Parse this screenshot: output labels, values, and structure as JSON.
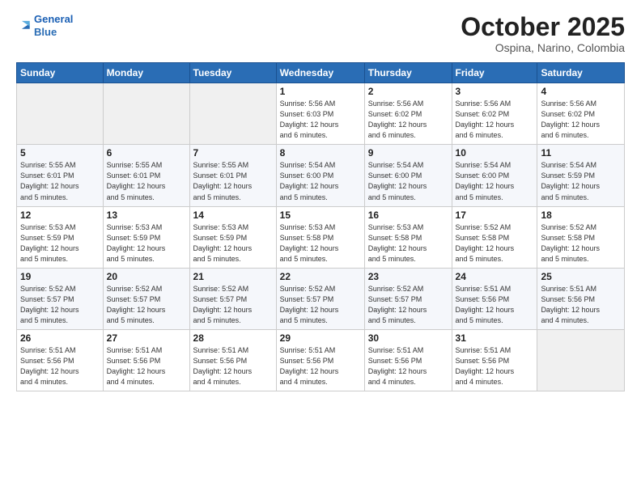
{
  "logo": {
    "line1": "General",
    "line2": "Blue"
  },
  "title": "October 2025",
  "subtitle": "Ospina, Narino, Colombia",
  "weekdays": [
    "Sunday",
    "Monday",
    "Tuesday",
    "Wednesday",
    "Thursday",
    "Friday",
    "Saturday"
  ],
  "weeks": [
    [
      {
        "day": "",
        "info": ""
      },
      {
        "day": "",
        "info": ""
      },
      {
        "day": "",
        "info": ""
      },
      {
        "day": "1",
        "info": "Sunrise: 5:56 AM\nSunset: 6:03 PM\nDaylight: 12 hours\nand 6 minutes."
      },
      {
        "day": "2",
        "info": "Sunrise: 5:56 AM\nSunset: 6:02 PM\nDaylight: 12 hours\nand 6 minutes."
      },
      {
        "day": "3",
        "info": "Sunrise: 5:56 AM\nSunset: 6:02 PM\nDaylight: 12 hours\nand 6 minutes."
      },
      {
        "day": "4",
        "info": "Sunrise: 5:56 AM\nSunset: 6:02 PM\nDaylight: 12 hours\nand 6 minutes."
      }
    ],
    [
      {
        "day": "5",
        "info": "Sunrise: 5:55 AM\nSunset: 6:01 PM\nDaylight: 12 hours\nand 5 minutes."
      },
      {
        "day": "6",
        "info": "Sunrise: 5:55 AM\nSunset: 6:01 PM\nDaylight: 12 hours\nand 5 minutes."
      },
      {
        "day": "7",
        "info": "Sunrise: 5:55 AM\nSunset: 6:01 PM\nDaylight: 12 hours\nand 5 minutes."
      },
      {
        "day": "8",
        "info": "Sunrise: 5:54 AM\nSunset: 6:00 PM\nDaylight: 12 hours\nand 5 minutes."
      },
      {
        "day": "9",
        "info": "Sunrise: 5:54 AM\nSunset: 6:00 PM\nDaylight: 12 hours\nand 5 minutes."
      },
      {
        "day": "10",
        "info": "Sunrise: 5:54 AM\nSunset: 6:00 PM\nDaylight: 12 hours\nand 5 minutes."
      },
      {
        "day": "11",
        "info": "Sunrise: 5:54 AM\nSunset: 5:59 PM\nDaylight: 12 hours\nand 5 minutes."
      }
    ],
    [
      {
        "day": "12",
        "info": "Sunrise: 5:53 AM\nSunset: 5:59 PM\nDaylight: 12 hours\nand 5 minutes."
      },
      {
        "day": "13",
        "info": "Sunrise: 5:53 AM\nSunset: 5:59 PM\nDaylight: 12 hours\nand 5 minutes."
      },
      {
        "day": "14",
        "info": "Sunrise: 5:53 AM\nSunset: 5:59 PM\nDaylight: 12 hours\nand 5 minutes."
      },
      {
        "day": "15",
        "info": "Sunrise: 5:53 AM\nSunset: 5:58 PM\nDaylight: 12 hours\nand 5 minutes."
      },
      {
        "day": "16",
        "info": "Sunrise: 5:53 AM\nSunset: 5:58 PM\nDaylight: 12 hours\nand 5 minutes."
      },
      {
        "day": "17",
        "info": "Sunrise: 5:52 AM\nSunset: 5:58 PM\nDaylight: 12 hours\nand 5 minutes."
      },
      {
        "day": "18",
        "info": "Sunrise: 5:52 AM\nSunset: 5:58 PM\nDaylight: 12 hours\nand 5 minutes."
      }
    ],
    [
      {
        "day": "19",
        "info": "Sunrise: 5:52 AM\nSunset: 5:57 PM\nDaylight: 12 hours\nand 5 minutes."
      },
      {
        "day": "20",
        "info": "Sunrise: 5:52 AM\nSunset: 5:57 PM\nDaylight: 12 hours\nand 5 minutes."
      },
      {
        "day": "21",
        "info": "Sunrise: 5:52 AM\nSunset: 5:57 PM\nDaylight: 12 hours\nand 5 minutes."
      },
      {
        "day": "22",
        "info": "Sunrise: 5:52 AM\nSunset: 5:57 PM\nDaylight: 12 hours\nand 5 minutes."
      },
      {
        "day": "23",
        "info": "Sunrise: 5:52 AM\nSunset: 5:57 PM\nDaylight: 12 hours\nand 5 minutes."
      },
      {
        "day": "24",
        "info": "Sunrise: 5:51 AM\nSunset: 5:56 PM\nDaylight: 12 hours\nand 5 minutes."
      },
      {
        "day": "25",
        "info": "Sunrise: 5:51 AM\nSunset: 5:56 PM\nDaylight: 12 hours\nand 4 minutes."
      }
    ],
    [
      {
        "day": "26",
        "info": "Sunrise: 5:51 AM\nSunset: 5:56 PM\nDaylight: 12 hours\nand 4 minutes."
      },
      {
        "day": "27",
        "info": "Sunrise: 5:51 AM\nSunset: 5:56 PM\nDaylight: 12 hours\nand 4 minutes."
      },
      {
        "day": "28",
        "info": "Sunrise: 5:51 AM\nSunset: 5:56 PM\nDaylight: 12 hours\nand 4 minutes."
      },
      {
        "day": "29",
        "info": "Sunrise: 5:51 AM\nSunset: 5:56 PM\nDaylight: 12 hours\nand 4 minutes."
      },
      {
        "day": "30",
        "info": "Sunrise: 5:51 AM\nSunset: 5:56 PM\nDaylight: 12 hours\nand 4 minutes."
      },
      {
        "day": "31",
        "info": "Sunrise: 5:51 AM\nSunset: 5:56 PM\nDaylight: 12 hours\nand 4 minutes."
      },
      {
        "day": "",
        "info": ""
      }
    ]
  ]
}
